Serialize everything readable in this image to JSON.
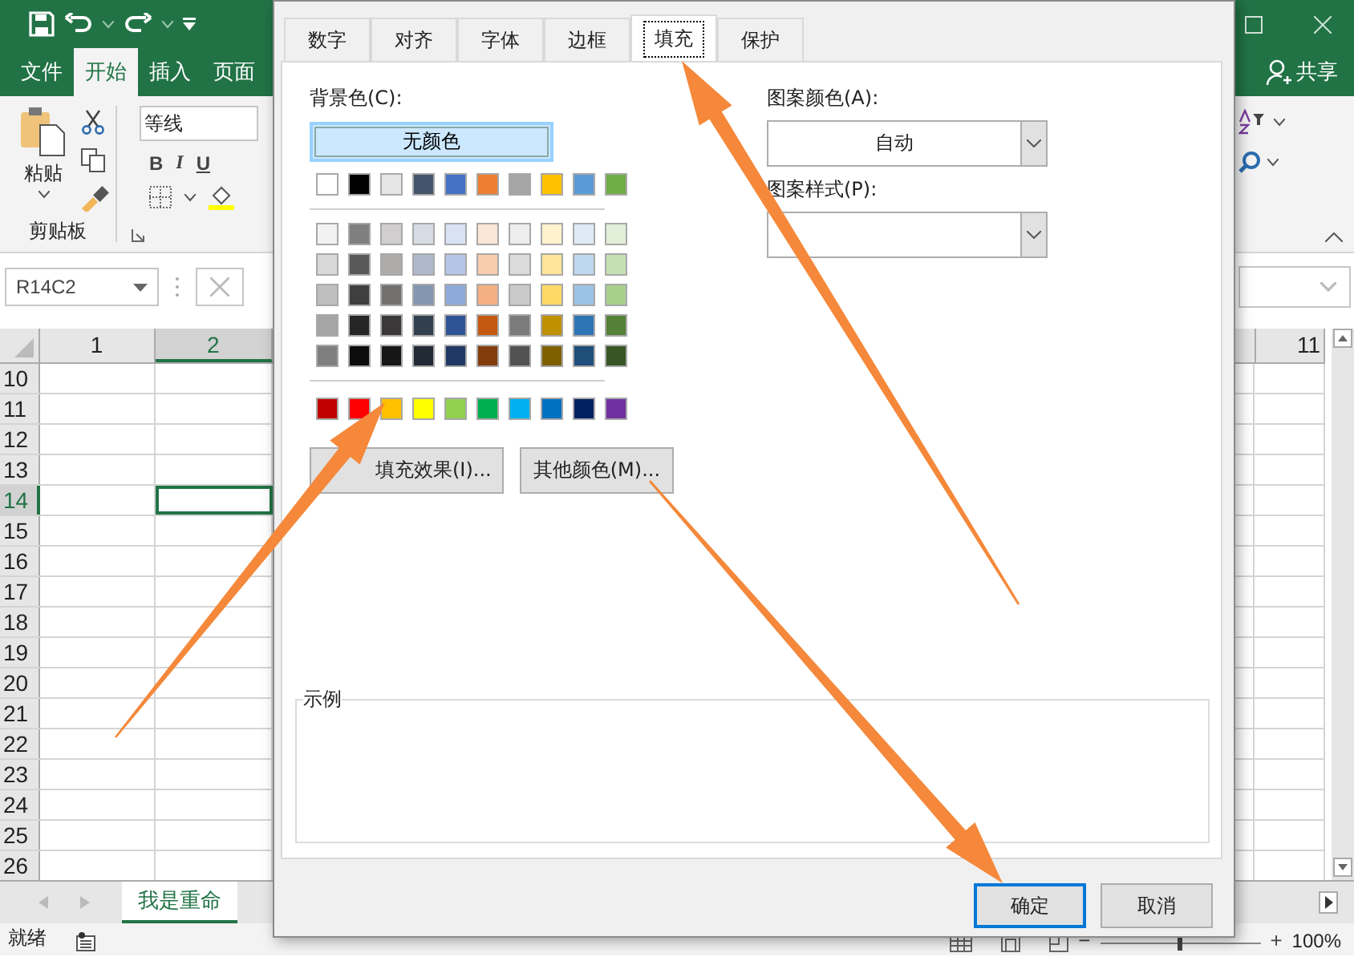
{
  "excel": {
    "ribbon_tabs": [
      {
        "label": "文件",
        "selected": false
      },
      {
        "label": "开始",
        "selected": true
      },
      {
        "label": "插入",
        "selected": false
      },
      {
        "label": "页面",
        "selected": false
      }
    ],
    "share": "共享",
    "paste": "粘贴",
    "clipboard_group": "剪贴板",
    "font_name": "等线",
    "format_buttons": [
      "B",
      "I",
      "U"
    ],
    "name_box": "R14C2",
    "columns": [
      {
        "label": "1",
        "selected": false
      },
      {
        "label": "2",
        "selected": true
      },
      {
        "label": "11",
        "selected": false
      }
    ],
    "rows": [
      {
        "label": "10",
        "selected": false
      },
      {
        "label": "11",
        "selected": false
      },
      {
        "label": "12",
        "selected": false
      },
      {
        "label": "13",
        "selected": false
      },
      {
        "label": "14",
        "selected": true
      },
      {
        "label": "15",
        "selected": false
      },
      {
        "label": "16",
        "selected": false
      },
      {
        "label": "17",
        "selected": false
      },
      {
        "label": "18",
        "selected": false
      },
      {
        "label": "19",
        "selected": false
      },
      {
        "label": "20",
        "selected": false
      },
      {
        "label": "21",
        "selected": false
      },
      {
        "label": "22",
        "selected": false
      },
      {
        "label": "23",
        "selected": false
      },
      {
        "label": "24",
        "selected": false
      },
      {
        "label": "25",
        "selected": false
      },
      {
        "label": "26",
        "selected": false
      }
    ],
    "sheet_tabs": [
      {
        "label": "我是重命",
        "selected": true
      }
    ],
    "status": "就绪",
    "zoom_out": "−",
    "zoom_slider": {
      "level": 0.5
    },
    "zoom_in": "+",
    "zoom": "100%"
  },
  "dialog": {
    "tabs": [
      {
        "label": "数字",
        "selected": false
      },
      {
        "label": "对齐",
        "selected": false
      },
      {
        "label": "字体",
        "selected": false
      },
      {
        "label": "边框",
        "selected": false
      },
      {
        "label": "填充",
        "selected": true
      },
      {
        "label": "保护",
        "selected": false
      }
    ],
    "background_label": "背景色(C):",
    "no_color": "无颜色",
    "theme_colors": [
      {
        "color": "#ffffff"
      },
      {
        "color": "#000000"
      },
      {
        "color": "#e7e6e6"
      },
      {
        "color": "#44546a"
      },
      {
        "color": "#4472c4"
      },
      {
        "color": "#ed7d31"
      },
      {
        "color": "#a5a5a5"
      },
      {
        "color": "#ffc000"
      },
      {
        "color": "#5b9bd5"
      },
      {
        "color": "#70ad47"
      }
    ],
    "tint_rows": [
      [
        {
          "color": "#f2f2f2"
        },
        {
          "color": "#7f7f7f"
        },
        {
          "color": "#d0cece"
        },
        {
          "color": "#d6dce4"
        },
        {
          "color": "#d9e2f3"
        },
        {
          "color": "#fbe5d5"
        },
        {
          "color": "#ededed"
        },
        {
          "color": "#fff2cc"
        },
        {
          "color": "#deebf6"
        },
        {
          "color": "#e2efd9"
        }
      ],
      [
        {
          "color": "#d8d8d8"
        },
        {
          "color": "#595959"
        },
        {
          "color": "#aeabab"
        },
        {
          "color": "#adb9ca"
        },
        {
          "color": "#b4c6e7"
        },
        {
          "color": "#f7cbac"
        },
        {
          "color": "#dbdbdb"
        },
        {
          "color": "#fee599"
        },
        {
          "color": "#bdd7ee"
        },
        {
          "color": "#c5e0b3"
        }
      ],
      [
        {
          "color": "#bfbfbf"
        },
        {
          "color": "#3f3f3f"
        },
        {
          "color": "#757070"
        },
        {
          "color": "#8496b0"
        },
        {
          "color": "#8eaadb"
        },
        {
          "color": "#f4b083"
        },
        {
          "color": "#c9c9c9"
        },
        {
          "color": "#ffd965"
        },
        {
          "color": "#9cc3e5"
        },
        {
          "color": "#a8d08d"
        }
      ],
      [
        {
          "color": "#a5a5a5"
        },
        {
          "color": "#262626"
        },
        {
          "color": "#3a3838"
        },
        {
          "color": "#323f4f"
        },
        {
          "color": "#2f5496"
        },
        {
          "color": "#c45911"
        },
        {
          "color": "#7b7b7b"
        },
        {
          "color": "#bf9000"
        },
        {
          "color": "#2e75b5"
        },
        {
          "color": "#538135"
        }
      ],
      [
        {
          "color": "#7f7f7f"
        },
        {
          "color": "#0c0c0c"
        },
        {
          "color": "#171616"
        },
        {
          "color": "#222a35"
        },
        {
          "color": "#1f3864"
        },
        {
          "color": "#833c0b"
        },
        {
          "color": "#525252"
        },
        {
          "color": "#7f6000"
        },
        {
          "color": "#1e4e79"
        },
        {
          "color": "#375623"
        }
      ]
    ],
    "standard_colors": [
      {
        "color": "#c00000"
      },
      {
        "color": "#ff0000"
      },
      {
        "color": "#ffc000"
      },
      {
        "color": "#ffff00"
      },
      {
        "color": "#92d050"
      },
      {
        "color": "#00b050"
      },
      {
        "color": "#00b0f0"
      },
      {
        "color": "#0070c0"
      },
      {
        "color": "#002060"
      },
      {
        "color": "#7030a0"
      }
    ],
    "fill_effects": "填充效果(I)...",
    "more_colors": "其他颜色(M)...",
    "pattern_color_label": "图案颜色(A):",
    "pattern_color": "自动",
    "pattern_style_label": "图案样式(P):",
    "sample_label": "示例",
    "ok": "确定",
    "cancel": "取消"
  }
}
